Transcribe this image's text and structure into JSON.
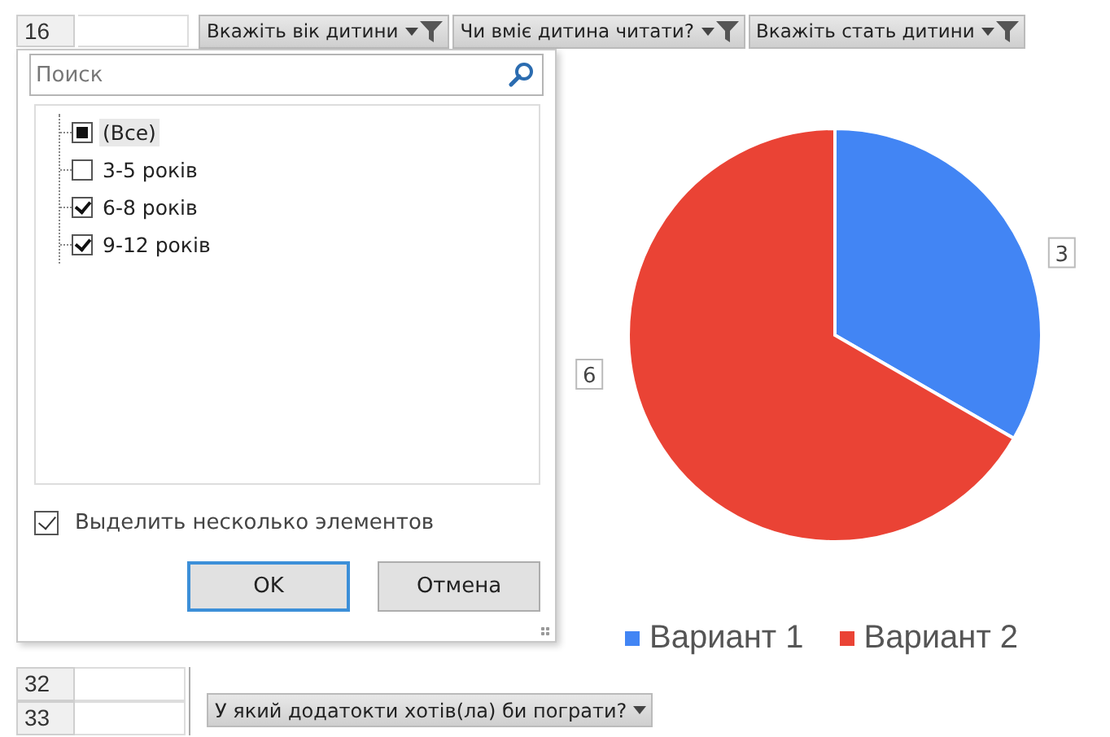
{
  "sheet_top": {
    "row_number": "16"
  },
  "filter_buttons": [
    {
      "label": "Вкажіть вік дитини",
      "filtered": true
    },
    {
      "label": "Чи вміє дитина читати?",
      "filtered": true
    },
    {
      "label": "Вкажіть стать дитини",
      "filtered": true
    }
  ],
  "filter_dialog": {
    "search": {
      "placeholder": "Поиск"
    },
    "items": [
      {
        "label": "(Все)",
        "checked": false,
        "indeterminate": true,
        "selected": true
      },
      {
        "label": "3-5 років",
        "checked": false,
        "indeterminate": false,
        "selected": false
      },
      {
        "label": "6-8 років",
        "checked": true,
        "indeterminate": false,
        "selected": false
      },
      {
        "label": "9-12 років",
        "checked": true,
        "indeterminate": false,
        "selected": false
      }
    ],
    "multi_select": {
      "label": "Выделить несколько элементов",
      "checked": true
    },
    "buttons": [
      {
        "label": "OK",
        "default": true
      },
      {
        "label": "Отмена",
        "default": false
      }
    ]
  },
  "chart": {
    "chart_data": {
      "type": "pie",
      "categories": [
        "Вариант 1",
        "Вариант 2"
      ],
      "values": [
        3,
        6
      ],
      "colors": [
        "#4285f4",
        "#ea4335"
      ],
      "data_labels": true,
      "legend": "bottom"
    }
  },
  "sheet_bottom": {
    "rows": [
      "32",
      "33"
    ]
  },
  "bottom_filter_button": {
    "label": "У який додатокти хотів(ла) би пограти?",
    "filtered": false
  }
}
